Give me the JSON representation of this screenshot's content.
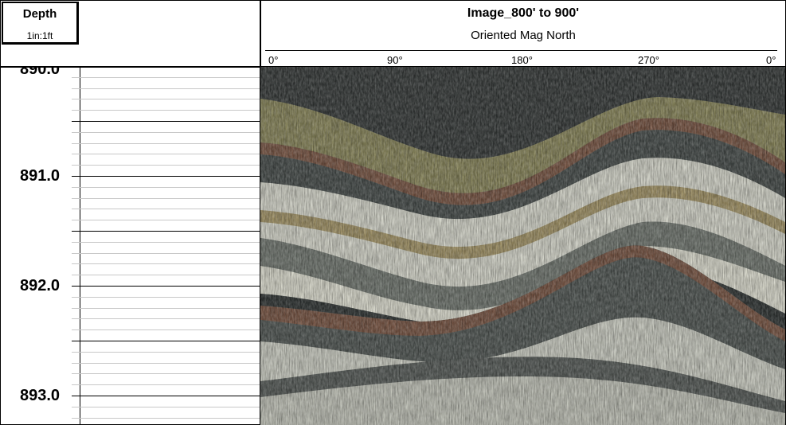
{
  "depth_header": {
    "title": "Depth",
    "scale": "1in:1ft"
  },
  "image_header": {
    "title": "Image_800' to 900'",
    "subtitle": "Oriented Mag North",
    "azimuth_labels": [
      "0°",
      "90°",
      "180°",
      "270°",
      "0°"
    ]
  },
  "depth_track": {
    "labels": [
      "890.0",
      "891.0",
      "892.0",
      "893.0"
    ],
    "depths": [
      890.0,
      891.0,
      892.0,
      893.0
    ],
    "visible_top": 890.0,
    "minor_ticks_per_foot": 10
  },
  "core_image": {
    "name": "borehole-core-image",
    "colors": {
      "dark_grey": "#3b3f3e",
      "mid_grey": "#6e7571",
      "pale_white": "#dfe0d4",
      "tan": "#a99a6c",
      "brown_band": "#7e5a48",
      "olive": "#8f8c60"
    }
  }
}
